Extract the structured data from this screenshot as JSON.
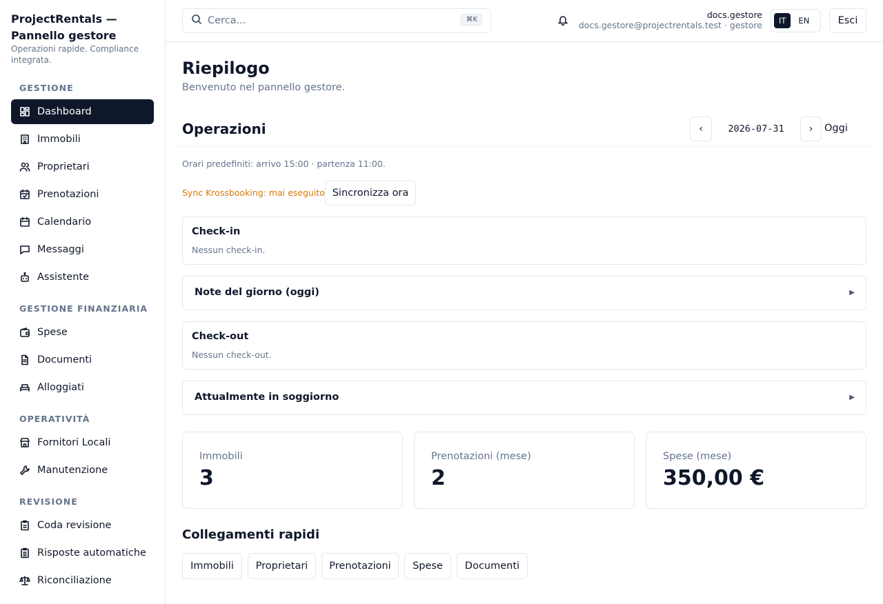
{
  "brand": {
    "title": "ProjectRentals — Pannello gestore",
    "subtitle": "Operazioni rapide. Compliance integrata."
  },
  "sidebar": {
    "sections": [
      {
        "label": "GESTIONE",
        "items": [
          {
            "label": "Dashboard",
            "icon": "dashboard-icon",
            "active": true
          },
          {
            "label": "Immobili",
            "icon": "building-icon"
          },
          {
            "label": "Proprietari",
            "icon": "users-icon"
          },
          {
            "label": "Prenotazioni",
            "icon": "calendar-check-icon"
          },
          {
            "label": "Calendario",
            "icon": "calendar-icon"
          },
          {
            "label": "Messaggi",
            "icon": "message-icon"
          },
          {
            "label": "Assistente",
            "icon": "bot-icon"
          }
        ]
      },
      {
        "label": "GESTIONE FINANZIARIA",
        "items": [
          {
            "label": "Spese",
            "icon": "wallet-icon"
          },
          {
            "label": "Documenti",
            "icon": "document-icon"
          },
          {
            "label": "Alloggiati",
            "icon": "bed-icon"
          }
        ]
      },
      {
        "label": "OPERATIVITÀ",
        "items": [
          {
            "label": "Fornitori Locali",
            "icon": "store-icon"
          },
          {
            "label": "Manutenzione",
            "icon": "wrench-icon"
          }
        ]
      },
      {
        "label": "REVISIONE",
        "items": [
          {
            "label": "Coda revisione",
            "icon": "clipboard-icon"
          },
          {
            "label": "Risposte automatiche",
            "icon": "clipboard-list-icon"
          },
          {
            "label": "Riconciliazione",
            "icon": "scale-icon"
          }
        ]
      }
    ]
  },
  "topbar": {
    "search_placeholder": "Cerca...",
    "search_shortcut": "⌘K",
    "user_name": "docs.gestore",
    "user_email_role": "docs.gestore@projectrentals.test · gestore",
    "lang_it": "IT",
    "lang_en": "EN",
    "logout_label": "Esci"
  },
  "page": {
    "title": "Riepilogo",
    "subtitle": "Benvenuto nel pannello gestore."
  },
  "operations": {
    "title": "Operazioni",
    "prev": "‹",
    "next": "›",
    "date": "2026-07-31",
    "today_label": "Oggi",
    "defaults_text": "Orari predefiniti: arrivo 15:00 · partenza 11:00.",
    "sync_status": "Sync Krossbooking: mai eseguito",
    "sync_button": "Sincronizza ora",
    "checkin_title": "Check-in",
    "checkin_empty": "Nessun check-in.",
    "notes_title": "Note del giorno (oggi)",
    "checkout_title": "Check-out",
    "checkout_empty": "Nessun check-out.",
    "staying_title": "Attualmente in soggiorno",
    "expand_glyph": "▶"
  },
  "stats": [
    {
      "label": "Immobili",
      "value": "3"
    },
    {
      "label": "Prenotazioni (mese)",
      "value": "2"
    },
    {
      "label": "Spese (mese)",
      "value": "350,00 €"
    }
  ],
  "quick_links": {
    "title": "Collegamenti rapidi",
    "items": [
      "Immobili",
      "Proprietari",
      "Prenotazioni",
      "Spese",
      "Documenti"
    ]
  }
}
